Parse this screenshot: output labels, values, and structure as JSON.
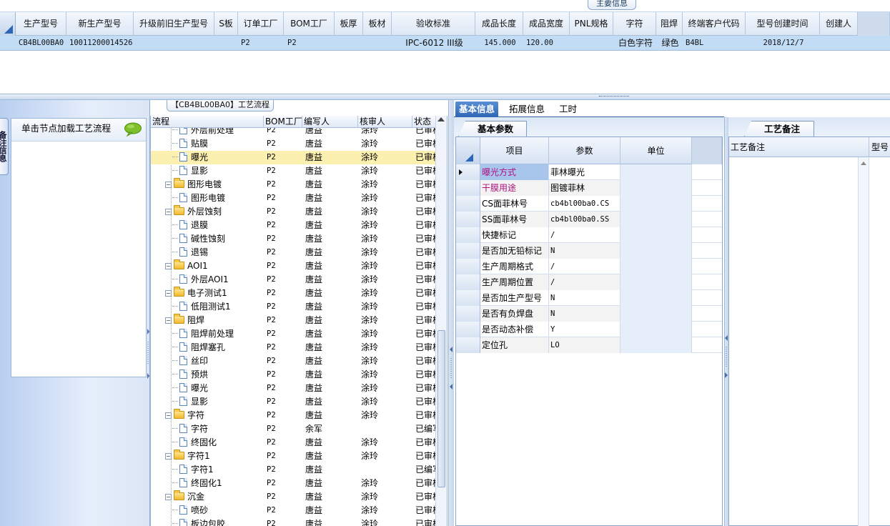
{
  "top_section": {
    "tab_label": "主要信息",
    "columns": [
      "生产型号",
      "新生产型号",
      "升级前旧生产型号",
      "S板",
      "订单工厂",
      "BOM工厂",
      "板厚",
      "板材",
      "验收标准",
      "成品长度",
      "成品宽度",
      "PNL规格",
      "字符",
      "阻焊",
      "终端客户代码",
      "型号创建时间",
      "创建人"
    ],
    "row": [
      "CB4BL00BA0",
      "10011200014526",
      "",
      "",
      "P2",
      "P2",
      "",
      "",
      "IPC-6012 III级",
      "145.000",
      "120.00",
      "",
      "白色字符",
      "绿色",
      "B4BL",
      "2018/12/7",
      ""
    ]
  },
  "left_panel": {
    "vertical_tab": "备注信息",
    "hint_text": "单击节点加载工艺流程"
  },
  "process_flow": {
    "title": "【CB4BL00BA0】工艺流程",
    "columns": [
      "流程",
      "BOM工厂",
      "编写人",
      "核审人",
      "状态"
    ],
    "rows": [
      {
        "level": 2,
        "type": "item",
        "name": "外层前处理",
        "bom": "P2",
        "writer": "唐益",
        "reviewer": "涂玲",
        "status": "已审核"
      },
      {
        "level": 2,
        "type": "item",
        "name": "贴膜",
        "bom": "P2",
        "writer": "唐益",
        "reviewer": "涂玲",
        "status": "已审核"
      },
      {
        "level": 2,
        "type": "item",
        "name": "曝光",
        "bom": "P2",
        "writer": "唐益",
        "reviewer": "涂玲",
        "status": "已审核",
        "selected": true
      },
      {
        "level": 2,
        "type": "item",
        "name": "显影",
        "bom": "P2",
        "writer": "唐益",
        "reviewer": "涂玲",
        "status": "已审核"
      },
      {
        "level": 1,
        "type": "group",
        "name": "图形电镀",
        "bom": "P2",
        "writer": "唐益",
        "reviewer": "涂玲",
        "status": "已审核"
      },
      {
        "level": 2,
        "type": "item",
        "name": "图形电镀",
        "bom": "P2",
        "writer": "唐益",
        "reviewer": "涂玲",
        "status": "已审核"
      },
      {
        "level": 1,
        "type": "group",
        "name": "外层蚀刻",
        "bom": "P2",
        "writer": "唐益",
        "reviewer": "涂玲",
        "status": "已审核"
      },
      {
        "level": 2,
        "type": "item",
        "name": "退膜",
        "bom": "P2",
        "writer": "唐益",
        "reviewer": "涂玲",
        "status": "已审核"
      },
      {
        "level": 2,
        "type": "item",
        "name": "碱性蚀刻",
        "bom": "P2",
        "writer": "唐益",
        "reviewer": "涂玲",
        "status": "已审核"
      },
      {
        "level": 2,
        "type": "item",
        "name": "退锡",
        "bom": "P2",
        "writer": "唐益",
        "reviewer": "涂玲",
        "status": "已审核"
      },
      {
        "level": 1,
        "type": "group",
        "name": "AOI1",
        "bom": "P2",
        "writer": "唐益",
        "reviewer": "涂玲",
        "status": "已审核"
      },
      {
        "level": 2,
        "type": "item",
        "name": "外层AOI1",
        "bom": "P2",
        "writer": "唐益",
        "reviewer": "涂玲",
        "status": "已审核"
      },
      {
        "level": 1,
        "type": "group",
        "name": "电子测试1",
        "bom": "P2",
        "writer": "唐益",
        "reviewer": "涂玲",
        "status": "已审核"
      },
      {
        "level": 2,
        "type": "item",
        "name": "低阻测试1",
        "bom": "P2",
        "writer": "唐益",
        "reviewer": "涂玲",
        "status": "已审核"
      },
      {
        "level": 1,
        "type": "group",
        "name": "阻焊",
        "bom": "P2",
        "writer": "唐益",
        "reviewer": "涂玲",
        "status": "已审核"
      },
      {
        "level": 2,
        "type": "item",
        "name": "阻焊前处理",
        "bom": "P2",
        "writer": "唐益",
        "reviewer": "涂玲",
        "status": "已审核"
      },
      {
        "level": 2,
        "type": "item",
        "name": "阻焊塞孔",
        "bom": "P2",
        "writer": "唐益",
        "reviewer": "涂玲",
        "status": "已审核"
      },
      {
        "level": 2,
        "type": "item",
        "name": "丝印",
        "bom": "P2",
        "writer": "唐益",
        "reviewer": "涂玲",
        "status": "已审核"
      },
      {
        "level": 2,
        "type": "item",
        "name": "预烘",
        "bom": "P2",
        "writer": "唐益",
        "reviewer": "涂玲",
        "status": "已审核"
      },
      {
        "level": 2,
        "type": "item",
        "name": "曝光",
        "bom": "P2",
        "writer": "唐益",
        "reviewer": "涂玲",
        "status": "已审核"
      },
      {
        "level": 2,
        "type": "item",
        "name": "显影",
        "bom": "P2",
        "writer": "唐益",
        "reviewer": "涂玲",
        "status": "已审核"
      },
      {
        "level": 1,
        "type": "group",
        "name": "字符",
        "bom": "P2",
        "writer": "唐益",
        "reviewer": "涂玲",
        "status": "已审核"
      },
      {
        "level": 2,
        "type": "item",
        "name": "字符",
        "bom": "P2",
        "writer": "余军",
        "reviewer": "",
        "status": "已编写"
      },
      {
        "level": 2,
        "type": "item",
        "name": "终固化",
        "bom": "P2",
        "writer": "唐益",
        "reviewer": "涂玲",
        "status": "已审核"
      },
      {
        "level": 1,
        "type": "group",
        "name": "字符1",
        "bom": "P2",
        "writer": "唐益",
        "reviewer": "涂玲",
        "status": "已审核"
      },
      {
        "level": 2,
        "type": "item",
        "name": "字符1",
        "bom": "P2",
        "writer": "唐益",
        "reviewer": "",
        "status": "已编写"
      },
      {
        "level": 2,
        "type": "item",
        "name": "终固化1",
        "bom": "P2",
        "writer": "唐益",
        "reviewer": "涂玲",
        "status": "已审核"
      },
      {
        "level": 1,
        "type": "group",
        "name": "沉金",
        "bom": "P2",
        "writer": "唐益",
        "reviewer": "涂玲",
        "status": "已审核"
      },
      {
        "level": 2,
        "type": "item",
        "name": "喷砂",
        "bom": "P2",
        "writer": "唐益",
        "reviewer": "涂玲",
        "status": "已审核"
      },
      {
        "level": 2,
        "type": "item",
        "name": "板边包胶",
        "bom": "P2",
        "writer": "唐益",
        "reviewer": "涂玲",
        "status": "已审核"
      }
    ]
  },
  "info_tabs": [
    "基本信息",
    "拓展信息",
    "工时"
  ],
  "basic_params": {
    "tab_label": "基本参数",
    "columns": [
      "项目",
      "参数",
      "单位"
    ],
    "rows": [
      {
        "key": "曝光方式",
        "value": "菲林曝光",
        "unit": "",
        "current": true,
        "pink": true
      },
      {
        "key": "干膜用途",
        "value": "图镀菲林",
        "unit": "",
        "pink": true
      },
      {
        "key": "CS面菲林号",
        "value": "cb4bl00ba0.CS",
        "unit": "",
        "mono": true
      },
      {
        "key": "SS面菲林号",
        "value": "cb4bl00ba0.SS",
        "unit": "",
        "mono": true
      },
      {
        "key": "快捷标记",
        "value": "/",
        "unit": "",
        "mono": true
      },
      {
        "key": "是否加无铅标记",
        "value": "N",
        "unit": "",
        "mono": true
      },
      {
        "key": "生产周期格式",
        "value": "/",
        "unit": "",
        "mono": true
      },
      {
        "key": "生产周期位置",
        "value": "/",
        "unit": "",
        "mono": true
      },
      {
        "key": "是否加生产型号",
        "value": "N",
        "unit": "",
        "mono": true
      },
      {
        "key": "是否有负焊盘",
        "value": "N",
        "unit": "",
        "mono": true
      },
      {
        "key": "是否动态补偿",
        "value": "Y",
        "unit": "",
        "mono": true
      },
      {
        "key": "定位孔",
        "value": "LO",
        "unit": "",
        "mono": true
      }
    ]
  },
  "notes": {
    "tab_label": "工艺备注",
    "columns": [
      "工艺备注",
      "型号"
    ]
  },
  "colors": {
    "accent": "#2d67b5",
    "selected_row": "#c2dcf6",
    "tree_selected": "#fcf0b0",
    "highlight_text": "#b01080"
  },
  "icons": {
    "hint": "speech-bubble-icon",
    "group": "folder-icon",
    "item": "document-icon"
  }
}
